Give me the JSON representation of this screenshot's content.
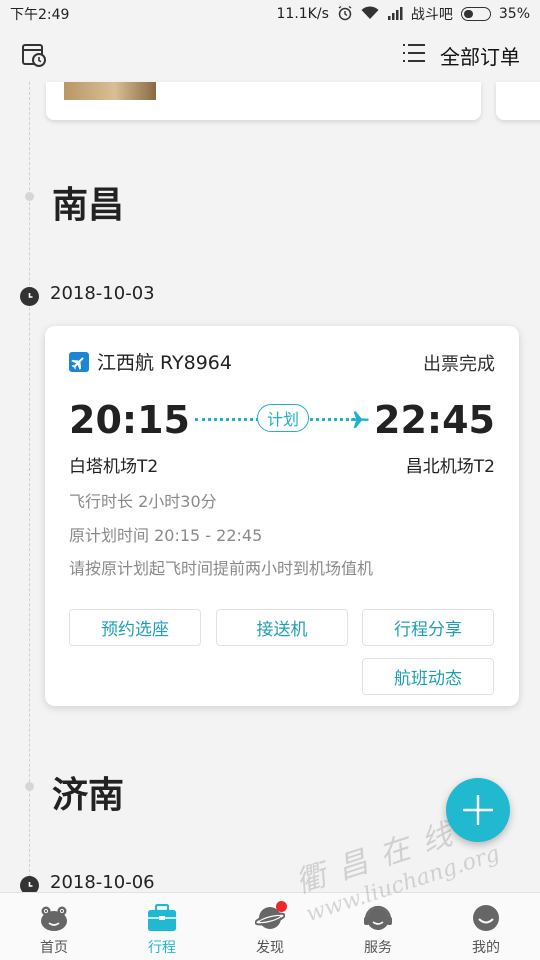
{
  "status_bar": {
    "time": "下午2:49",
    "speed": "11.1K/s",
    "carrier": "战斗吧",
    "battery": "35%"
  },
  "header": {
    "orders_label": "全部订单"
  },
  "sections": [
    {
      "city": "南昌",
      "date": "2018-10-03",
      "flight": {
        "airline_flight": "江西航 RY8964",
        "status": "出票完成",
        "depart_time": "20:15",
        "arrive_time": "22:45",
        "plan_label": "计划",
        "depart_airport": "白塔机场T2",
        "arrive_airport": "昌北机场T2",
        "duration": "飞行时长  2小时30分",
        "original_schedule": "原计划时间  20:15 - 22:45",
        "notice": "请按原计划起飞时间提前两小时到机场值机",
        "actions": [
          "预约选座",
          "接送机",
          "行程分享",
          "航班动态"
        ]
      }
    },
    {
      "city": "济南",
      "date": "2018-10-06"
    }
  ],
  "bottom_nav": [
    {
      "label": "首页",
      "icon": "home-face-icon",
      "active": false
    },
    {
      "label": "行程",
      "icon": "briefcase-icon",
      "active": true
    },
    {
      "label": "发现",
      "icon": "planet-icon",
      "active": false
    },
    {
      "label": "服务",
      "icon": "headset-icon",
      "active": false
    },
    {
      "label": "我的",
      "icon": "smile-icon",
      "active": false
    }
  ],
  "watermark": {
    "chinese": "衢昌在线",
    "url": "www.liuchang.org"
  },
  "colors": {
    "accent": "#20b9d0",
    "notification": "#f1262c",
    "airline_badge": "#1b86d6"
  }
}
